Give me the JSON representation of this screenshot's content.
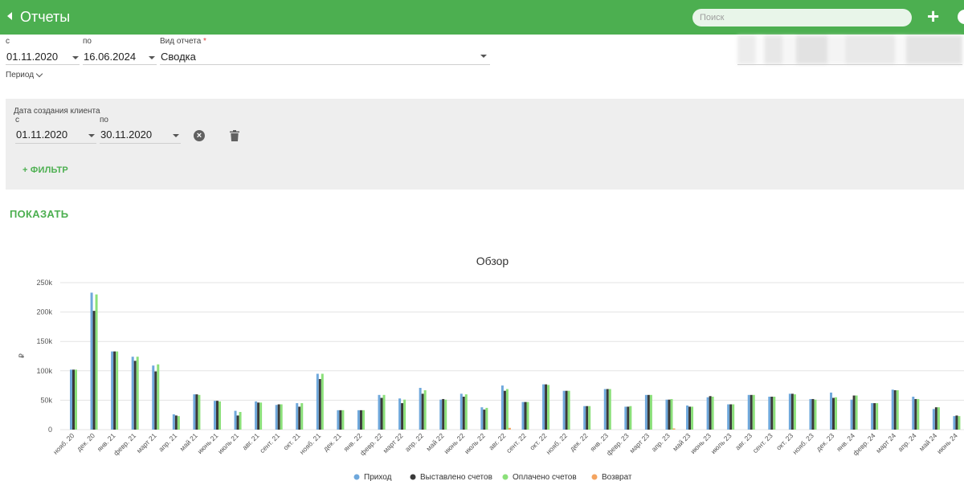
{
  "header": {
    "title": "Отчеты",
    "search_placeholder": "Поиск",
    "add_label": "+"
  },
  "params": {
    "from_label": "с",
    "from_value": "01.11.2020",
    "to_label": "по",
    "to_value": "16.06.2024",
    "report_type_label": "Вид отчета",
    "report_type_required": "*",
    "report_type_value": "Сводка",
    "period_label": "Период"
  },
  "filter": {
    "title": "Дата создания клиента",
    "from_label": "с",
    "from_value": "01.11.2020",
    "to_label": "по",
    "to_value": "30.11.2020",
    "add_filter_label": "+ ФИЛЬТР"
  },
  "show_button": "ПОКАЗАТЬ",
  "colors": {
    "accent": "#4caf50",
    "income": "#6fa8dc",
    "invoiced": "#3a3a3a",
    "paid": "#8be07a",
    "refund": "#f4a460"
  },
  "icons": {
    "back": "chevron-left-icon",
    "add": "plus-icon",
    "clear": "clear-circle-icon",
    "delete": "trash-icon"
  },
  "chart_data": {
    "type": "bar",
    "title": "Обзор",
    "ylabel": "₽",
    "ylim": [
      0,
      250000
    ],
    "yticks": [
      "0",
      "50k",
      "100k",
      "150k",
      "200k",
      "250k"
    ],
    "ytick_values": [
      0,
      50000,
      100000,
      150000,
      200000,
      250000
    ],
    "grid": true,
    "legend_position": "bottom",
    "categories": [
      "нояб. 20",
      "дек. 20",
      "янв. 21",
      "февр. 21",
      "март 21",
      "апр. 21",
      "май 21",
      "июнь 21",
      "июль 21",
      "авг. 21",
      "сент. 21",
      "окт. 21",
      "нояб. 21",
      "дек. 21",
      "янв. 22",
      "февр. 22",
      "март 22",
      "апр. 22",
      "май 22",
      "июнь 22",
      "июль 22",
      "авг. 22",
      "сент. 22",
      "окт. 22",
      "нояб. 22",
      "дек. 22",
      "янв. 23",
      "февр. 23",
      "март 23",
      "апр. 23",
      "май 23",
      "июнь 23",
      "июль 23",
      "авг. 23",
      "сент. 23",
      "окт. 23",
      "нояб. 23",
      "дек. 23",
      "янв. 24",
      "февр. 24",
      "март 24",
      "апр. 24",
      "май 24",
      "июнь 24"
    ],
    "series": [
      {
        "name": "Приход",
        "color": "#6fa8dc",
        "values": [
          102000,
          233000,
          133000,
          124000,
          109000,
          26000,
          60000,
          49000,
          32000,
          48000,
          42000,
          45000,
          95000,
          33000,
          33000,
          59000,
          53000,
          71000,
          51000,
          61000,
          38000,
          75000,
          47000,
          77000,
          66000,
          40000,
          69000,
          39000,
          59000,
          51000,
          41000,
          55000,
          43000,
          59000,
          56000,
          61000,
          52000,
          63000,
          51000,
          45000,
          68000,
          56000,
          35000,
          23000
        ]
      },
      {
        "name": "Выставлено счетов",
        "color": "#3a3a3a",
        "values": [
          102000,
          202000,
          133000,
          117000,
          99000,
          24000,
          60000,
          49000,
          24000,
          46000,
          43000,
          39000,
          86000,
          33000,
          33000,
          54000,
          45000,
          61000,
          52000,
          56000,
          34000,
          66000,
          47000,
          77000,
          66000,
          40000,
          69000,
          39000,
          59000,
          51000,
          39000,
          57000,
          43000,
          59000,
          56000,
          61000,
          52000,
          54000,
          58000,
          45000,
          67000,
          52000,
          38000,
          24000
        ]
      },
      {
        "name": "Оплачено счетов",
        "color": "#8be07a",
        "values": [
          102000,
          230000,
          133000,
          124000,
          111000,
          23000,
          59000,
          48000,
          30000,
          46000,
          43000,
          45000,
          95000,
          33000,
          33000,
          59000,
          51000,
          67000,
          51000,
          60000,
          37000,
          69000,
          47000,
          76000,
          66000,
          40000,
          69000,
          40000,
          59000,
          52000,
          39000,
          56000,
          43000,
          59000,
          56000,
          60000,
          51000,
          55000,
          58000,
          45000,
          67000,
          52000,
          38000,
          23000
        ]
      },
      {
        "name": "Возврат",
        "color": "#f4a460",
        "values": [
          0,
          0,
          0,
          0,
          0,
          0,
          0,
          0,
          0,
          0,
          0,
          0,
          0,
          0,
          0,
          0,
          0,
          0,
          0,
          0,
          0,
          3000,
          0,
          0,
          0,
          0,
          0,
          0,
          0,
          2000,
          0,
          0,
          0,
          0,
          0,
          0,
          0,
          0,
          0,
          0,
          0,
          0,
          0,
          0
        ]
      }
    ]
  }
}
